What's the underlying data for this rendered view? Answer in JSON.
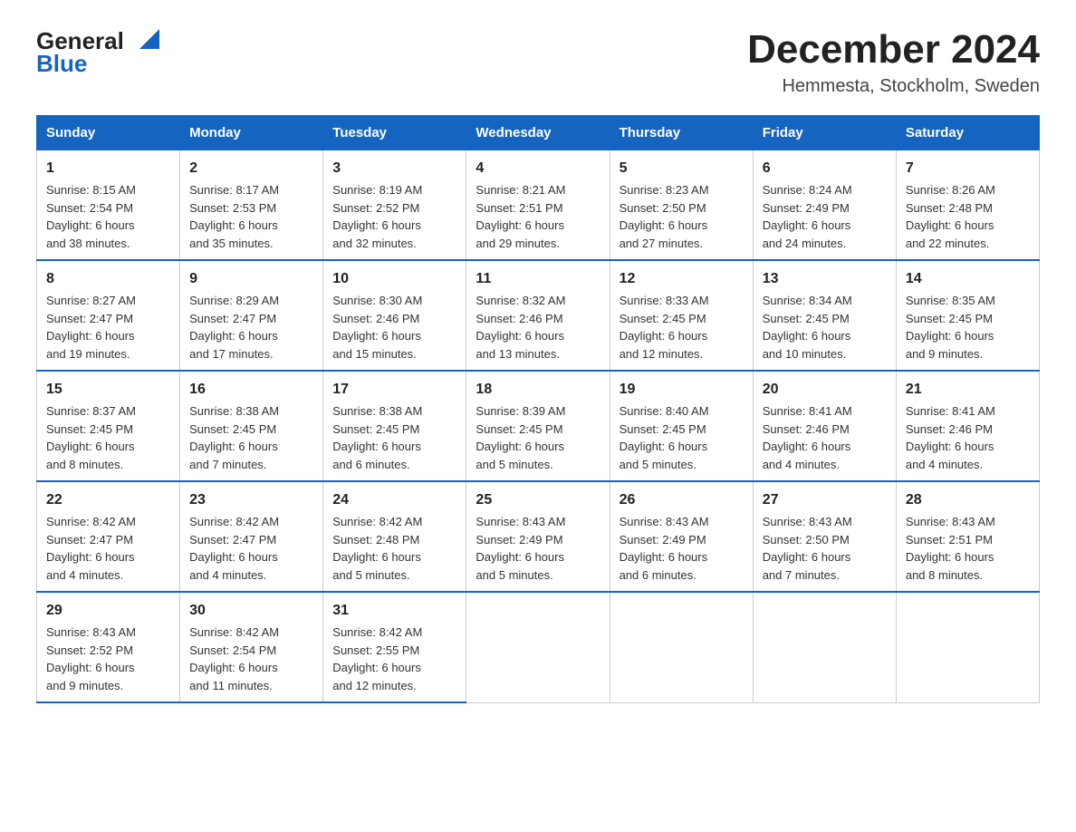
{
  "header": {
    "logo_line1": "General",
    "logo_line2": "Blue",
    "title": "December 2024",
    "subtitle": "Hemmesta, Stockholm, Sweden"
  },
  "days_of_week": [
    "Sunday",
    "Monday",
    "Tuesday",
    "Wednesday",
    "Thursday",
    "Friday",
    "Saturday"
  ],
  "weeks": [
    [
      {
        "day": "1",
        "sunrise": "8:15 AM",
        "sunset": "2:54 PM",
        "daylight": "6 hours and 38 minutes."
      },
      {
        "day": "2",
        "sunrise": "8:17 AM",
        "sunset": "2:53 PM",
        "daylight": "6 hours and 35 minutes."
      },
      {
        "day": "3",
        "sunrise": "8:19 AM",
        "sunset": "2:52 PM",
        "daylight": "6 hours and 32 minutes."
      },
      {
        "day": "4",
        "sunrise": "8:21 AM",
        "sunset": "2:51 PM",
        "daylight": "6 hours and 29 minutes."
      },
      {
        "day": "5",
        "sunrise": "8:23 AM",
        "sunset": "2:50 PM",
        "daylight": "6 hours and 27 minutes."
      },
      {
        "day": "6",
        "sunrise": "8:24 AM",
        "sunset": "2:49 PM",
        "daylight": "6 hours and 24 minutes."
      },
      {
        "day": "7",
        "sunrise": "8:26 AM",
        "sunset": "2:48 PM",
        "daylight": "6 hours and 22 minutes."
      }
    ],
    [
      {
        "day": "8",
        "sunrise": "8:27 AM",
        "sunset": "2:47 PM",
        "daylight": "6 hours and 19 minutes."
      },
      {
        "day": "9",
        "sunrise": "8:29 AM",
        "sunset": "2:47 PM",
        "daylight": "6 hours and 17 minutes."
      },
      {
        "day": "10",
        "sunrise": "8:30 AM",
        "sunset": "2:46 PM",
        "daylight": "6 hours and 15 minutes."
      },
      {
        "day": "11",
        "sunrise": "8:32 AM",
        "sunset": "2:46 PM",
        "daylight": "6 hours and 13 minutes."
      },
      {
        "day": "12",
        "sunrise": "8:33 AM",
        "sunset": "2:45 PM",
        "daylight": "6 hours and 12 minutes."
      },
      {
        "day": "13",
        "sunrise": "8:34 AM",
        "sunset": "2:45 PM",
        "daylight": "6 hours and 10 minutes."
      },
      {
        "day": "14",
        "sunrise": "8:35 AM",
        "sunset": "2:45 PM",
        "daylight": "6 hours and 9 minutes."
      }
    ],
    [
      {
        "day": "15",
        "sunrise": "8:37 AM",
        "sunset": "2:45 PM",
        "daylight": "6 hours and 8 minutes."
      },
      {
        "day": "16",
        "sunrise": "8:38 AM",
        "sunset": "2:45 PM",
        "daylight": "6 hours and 7 minutes."
      },
      {
        "day": "17",
        "sunrise": "8:38 AM",
        "sunset": "2:45 PM",
        "daylight": "6 hours and 6 minutes."
      },
      {
        "day": "18",
        "sunrise": "8:39 AM",
        "sunset": "2:45 PM",
        "daylight": "6 hours and 5 minutes."
      },
      {
        "day": "19",
        "sunrise": "8:40 AM",
        "sunset": "2:45 PM",
        "daylight": "6 hours and 5 minutes."
      },
      {
        "day": "20",
        "sunrise": "8:41 AM",
        "sunset": "2:46 PM",
        "daylight": "6 hours and 4 minutes."
      },
      {
        "day": "21",
        "sunrise": "8:41 AM",
        "sunset": "2:46 PM",
        "daylight": "6 hours and 4 minutes."
      }
    ],
    [
      {
        "day": "22",
        "sunrise": "8:42 AM",
        "sunset": "2:47 PM",
        "daylight": "6 hours and 4 minutes."
      },
      {
        "day": "23",
        "sunrise": "8:42 AM",
        "sunset": "2:47 PM",
        "daylight": "6 hours and 4 minutes."
      },
      {
        "day": "24",
        "sunrise": "8:42 AM",
        "sunset": "2:48 PM",
        "daylight": "6 hours and 5 minutes."
      },
      {
        "day": "25",
        "sunrise": "8:43 AM",
        "sunset": "2:49 PM",
        "daylight": "6 hours and 5 minutes."
      },
      {
        "day": "26",
        "sunrise": "8:43 AM",
        "sunset": "2:49 PM",
        "daylight": "6 hours and 6 minutes."
      },
      {
        "day": "27",
        "sunrise": "8:43 AM",
        "sunset": "2:50 PM",
        "daylight": "6 hours and 7 minutes."
      },
      {
        "day": "28",
        "sunrise": "8:43 AM",
        "sunset": "2:51 PM",
        "daylight": "6 hours and 8 minutes."
      }
    ],
    [
      {
        "day": "29",
        "sunrise": "8:43 AM",
        "sunset": "2:52 PM",
        "daylight": "6 hours and 9 minutes."
      },
      {
        "day": "30",
        "sunrise": "8:42 AM",
        "sunset": "2:54 PM",
        "daylight": "6 hours and 11 minutes."
      },
      {
        "day": "31",
        "sunrise": "8:42 AM",
        "sunset": "2:55 PM",
        "daylight": "6 hours and 12 minutes."
      },
      null,
      null,
      null,
      null
    ]
  ],
  "labels": {
    "sunrise": "Sunrise: ",
    "sunset": "Sunset: ",
    "daylight": "Daylight: "
  }
}
